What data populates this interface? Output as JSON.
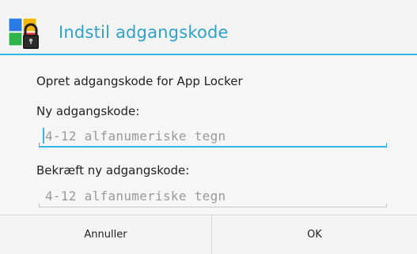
{
  "dialog": {
    "title": "Indstil adgangskode",
    "icon": "app-locker-icon"
  },
  "content": {
    "intro": "Opret adgangskode for App Locker",
    "new_label": "Ny adgangskode:",
    "new_placeholder": "4-12 alfanumeriske tegn",
    "confirm_label": "Bekræft ny adgangskode:",
    "confirm_placeholder": "4-12 alfanumeriske tegn"
  },
  "buttons": {
    "cancel": "Annuller",
    "ok": "OK"
  },
  "colors": {
    "accent": "#33b5e5",
    "title": "#2ea2cc"
  }
}
